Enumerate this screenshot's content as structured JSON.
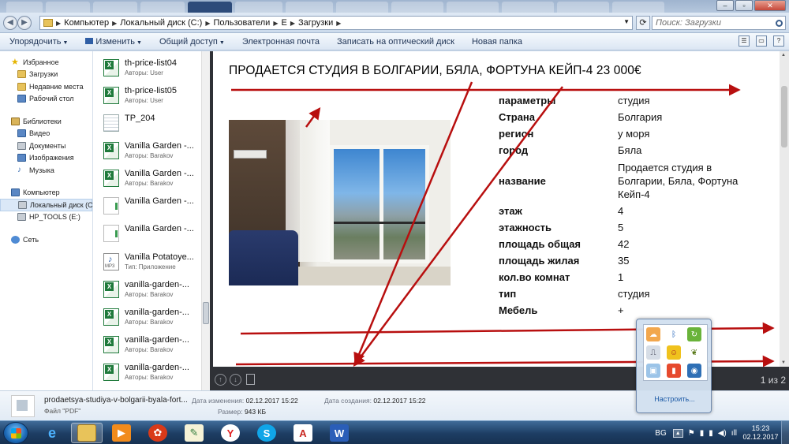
{
  "window": {
    "minimize_label": "–",
    "maximize_label": "▫",
    "close_label": "✕"
  },
  "address": {
    "crumbs": [
      "Компьютер",
      "Локальный диск (C:)",
      "Пользователи",
      "E",
      "Загрузки"
    ],
    "search_placeholder": "Поиск: Загрузки"
  },
  "toolbar": {
    "organize": "Упорядочить",
    "change": "Изменить",
    "share": "Общий доступ",
    "email": "Электронная почта",
    "burn": "Записать на оптический диск",
    "new_folder": "Новая папка"
  },
  "nav": {
    "favorites": "Избранное",
    "downloads": "Загрузки",
    "recent": "Недавние места",
    "desktop": "Рабочий стол",
    "libraries": "Библиотеки",
    "video": "Видео",
    "documents": "Документы",
    "images": "Изображения",
    "music": "Музыка",
    "computer": "Компьютер",
    "local_disk": "Локальный диск (C",
    "hp_tools": "HP_TOOLS (E:)",
    "network": "Сеть"
  },
  "files": [
    {
      "name": "th-price-list04",
      "meta": "Авторы: User",
      "icon": "xls"
    },
    {
      "name": "th-price-list05",
      "meta": "Авторы: User",
      "icon": "xls"
    },
    {
      "name": "TP_204",
      "meta": "",
      "icon": "doc"
    },
    {
      "name": "Vanilla Garden -...",
      "meta": "Авторы: Barakov",
      "icon": "xls"
    },
    {
      "name": "Vanilla Garden -...",
      "meta": "Авторы: Barakov",
      "icon": "xls"
    },
    {
      "name": "Vanilla Garden -...",
      "meta": "",
      "icon": "blank"
    },
    {
      "name": "Vanilla Garden -...",
      "meta": "",
      "icon": "blank"
    },
    {
      "name": "Vanilla Potatoye...",
      "meta": "Тип: Приложение",
      "icon": "mp3"
    },
    {
      "name": "vanilla-garden-...",
      "meta": "Авторы: Barakov",
      "icon": "xls"
    },
    {
      "name": "vanilla-garden-...",
      "meta": "Авторы: Barakov",
      "icon": "xls"
    },
    {
      "name": "vanilla-garden-...",
      "meta": "Авторы: Barakov",
      "icon": "xls"
    },
    {
      "name": "vanilla-garden-...",
      "meta": "Авторы: Barakov",
      "icon": "xls"
    }
  ],
  "pdf": {
    "title": "ПРОДАЕТСЯ СТУДИЯ В БОЛГАРИИ, БЯЛА, ФОРТУНА КЕЙП-4 23 000€",
    "params": [
      {
        "key": "параметры",
        "value": "студия"
      },
      {
        "key": "Страна",
        "value": "Болгария"
      },
      {
        "key": "регион",
        "value": "у моря"
      },
      {
        "key": "город",
        "value": "Бяла"
      },
      {
        "key": "название",
        "value": "Продается студия в Болгарии, Бяла, Фортуна Кейп-4"
      },
      {
        "key": "этаж",
        "value": "4"
      },
      {
        "key": "этажность",
        "value": "5"
      },
      {
        "key": "площадь общая",
        "value": "42"
      },
      {
        "key": "площадь жилая",
        "value": "35"
      },
      {
        "key": "кол.во комнат",
        "value": "1"
      },
      {
        "key": "тип",
        "value": "студия"
      },
      {
        "key": "Мебель",
        "value": "+"
      }
    ],
    "page_counter": "1 из 2"
  },
  "details": {
    "file_name": "prodaetsya-studiya-v-bolgarii-byala-fort...",
    "file_type": "Файл \"PDF\"",
    "modified_label": "Дата изменения:",
    "modified_value": "02.12.2017 15:22",
    "created_label": "Дата создания:",
    "created_value": "02.12.2017 15:22",
    "size_label": "Размер:",
    "size_value": "943 КБ"
  },
  "tray_popup": {
    "customize": "Настроить..."
  },
  "taskbar": {
    "lang": "BG",
    "time": "15:23",
    "date": "02.12.2017"
  },
  "colors": {
    "annotation_arrow": "#b80f0f",
    "viewer_background": "#2f3136",
    "taskbar": "#1d3d63"
  }
}
